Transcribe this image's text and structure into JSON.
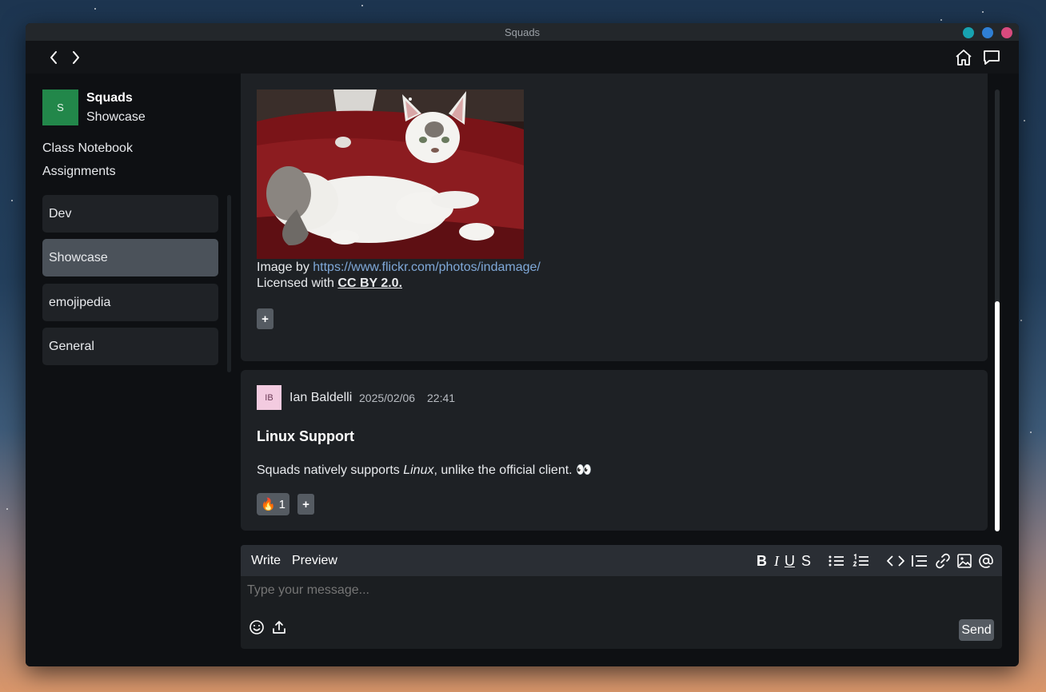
{
  "window": {
    "title": "Squads"
  },
  "colors": {
    "accent_green": "#22874a",
    "link": "#7fa8d8",
    "win_teal": "#17a2b0",
    "win_blue": "#2f7fd4",
    "win_pink": "#d84a7e"
  },
  "icons": {
    "back": "chevron-left-icon",
    "forward": "chevron-right-icon",
    "home": "home-icon",
    "chat": "chat-bubble-icon"
  },
  "sidebar": {
    "avatar_letter": "S",
    "squad_name": "Squads",
    "squad_sub": "Showcase",
    "links": [
      "Class Notebook",
      "Assignments"
    ],
    "channels": [
      {
        "label": "Dev",
        "active": false
      },
      {
        "label": "Showcase",
        "active": true
      },
      {
        "label": "emojipedia",
        "active": false
      },
      {
        "label": "General",
        "active": false
      }
    ]
  },
  "post1": {
    "image_by_text": "Image by ",
    "image_link": "https://www.flickr.com/photos/indamage/",
    "license_text": "Licensed with ",
    "license_name": "CC BY 2.0.",
    "add_reaction": "+"
  },
  "post2": {
    "avatar_initials": "IB",
    "author": "Ian Baldelli",
    "date": "2025/02/06",
    "time": "22:41",
    "title": "Linux Support",
    "body_before": "Squads natively supports ",
    "body_italic": "Linux",
    "body_after": ", unlike the official client. ",
    "body_emoji": "👀",
    "reaction_emoji": "🔥",
    "reaction_count": "1",
    "add_reaction": "+"
  },
  "composer": {
    "tabs": [
      "Write",
      "Preview"
    ],
    "format": {
      "bold": "B",
      "italic": "I",
      "underline": "U",
      "strike": "S"
    },
    "placeholder": "Type your message...",
    "send_label": "Send"
  }
}
